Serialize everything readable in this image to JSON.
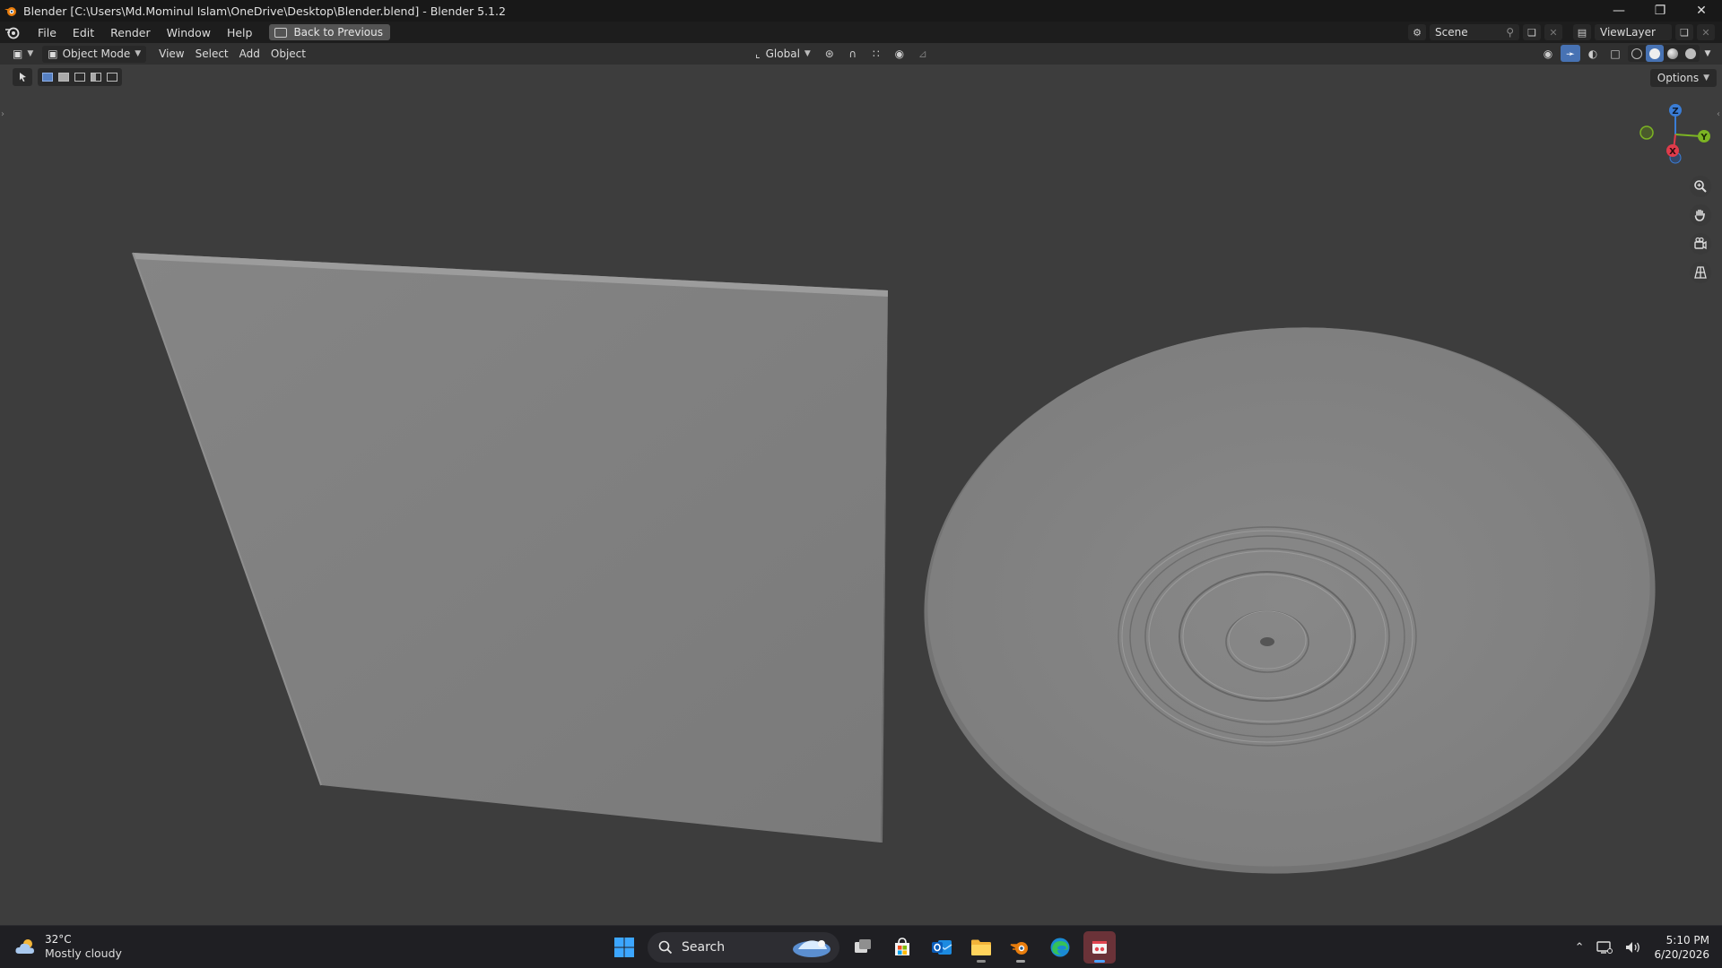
{
  "window": {
    "title": "Blender [C:\\Users\\Md.Mominul Islam\\OneDrive\\Desktop\\Blender.blend] - Blender 5.1.2"
  },
  "menubar": {
    "items": [
      "File",
      "Edit",
      "Render",
      "Window",
      "Help"
    ],
    "back_button": "Back to Previous",
    "scene_name": "Scene",
    "view_layer": "ViewLayer"
  },
  "viewport_header": {
    "mode": "Object Mode",
    "menus": [
      "View",
      "Select",
      "Add",
      "Object"
    ],
    "transform_orientation": "Global"
  },
  "toolbar": {
    "options_label": "Options"
  },
  "gizmo": {
    "z": "Z",
    "y": "Y",
    "x": "X",
    "colors": {
      "x": "#e03b4b",
      "y": "#7cb423",
      "z": "#3a7dd6"
    }
  },
  "taskbar": {
    "weather_temp": "32°C",
    "weather_condition": "Mostly cloudy",
    "search_label": "Search",
    "time": "5:10 PM",
    "date": "6/20/2026"
  }
}
